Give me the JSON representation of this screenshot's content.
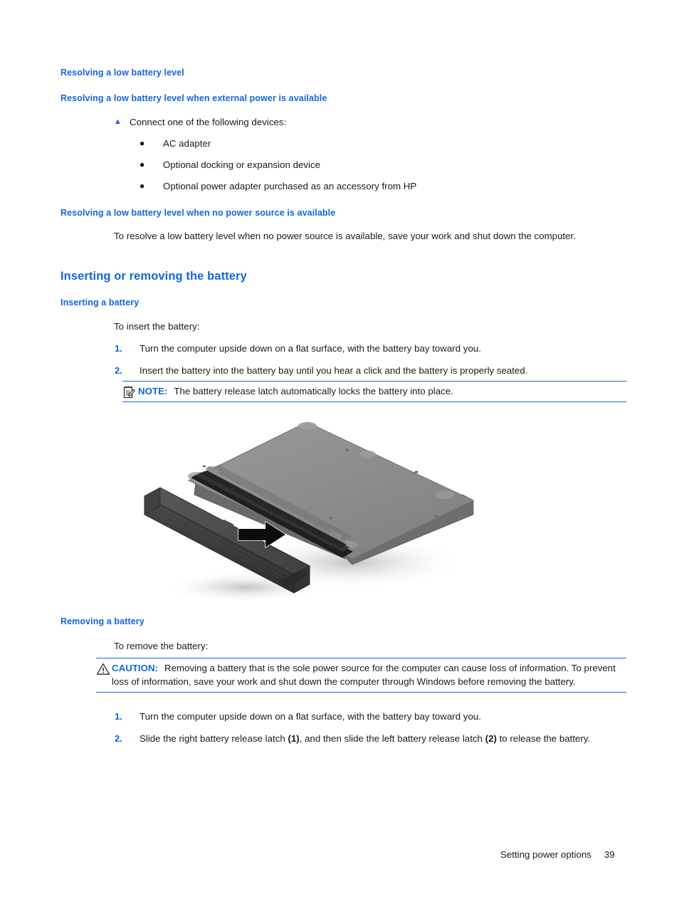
{
  "document": {
    "headings": {
      "resolving_low_battery": "Resolving a low battery level",
      "resolving_external_power": "Resolving a low battery level when external power is available",
      "resolving_no_power": "Resolving a low battery level when no power source is available",
      "inserting_removing": "Inserting or removing the battery",
      "inserting_battery": "Inserting a battery",
      "removing_battery": "Removing a battery"
    },
    "connect_step": {
      "marker": "▲",
      "text": "Connect one of the following devices:"
    },
    "device_bullets": [
      {
        "marker": "●",
        "label": "AC adapter"
      },
      {
        "marker": "●",
        "label": "Optional docking or expansion device"
      },
      {
        "marker": "●",
        "label": "Optional power adapter purchased as an accessory from HP"
      }
    ],
    "no_power_paragraph": "To resolve a low battery level when no power source is available, save your work and shut down the computer.",
    "insert_intro": "To insert the battery:",
    "insert_steps": [
      {
        "marker": "1.",
        "text": "Turn the computer upside down on a flat surface, with the battery bay toward you."
      },
      {
        "marker": "2.",
        "text": "Insert the battery into the battery bay until you hear a click and the battery is properly seated."
      }
    ],
    "note": {
      "icon": "note-icon",
      "keyword": "NOTE:",
      "text": "The battery release latch automatically locks the battery into place."
    },
    "figure": {
      "name": "battery-insertion-illustration",
      "description": "Laptop shown upside down with battery being inserted into the battery bay, arrow indicating insertion direction",
      "colors": {
        "laptop_body": "#8d8d8d",
        "laptop_edge": "#6f6f6f",
        "battery": "#3c3c3c",
        "bay_shadow": "#2a2a2a",
        "arrow": "#111111"
      }
    },
    "remove_intro": "To remove the battery:",
    "caution": {
      "icon": "warning-triangle-icon",
      "keyword": "CAUTION:",
      "text": "Removing a battery that is the sole power source for the computer can cause loss of information. To prevent loss of information, save your work and shut down the computer through Windows before removing the battery."
    },
    "remove_steps": [
      {
        "marker": "1.",
        "text_before": "Turn the computer upside down on a flat surface, with the battery bay toward you.",
        "bold1": "",
        "text_mid": "",
        "bold2": "",
        "text_after": ""
      },
      {
        "marker": "2.",
        "text_before": "Slide the right battery release latch ",
        "bold1": "(1)",
        "text_mid": ", and then slide the left battery release latch ",
        "bold2": "(2)",
        "text_after": " to release the battery."
      }
    ],
    "footer": {
      "section": "Setting power options",
      "page_number": "39"
    },
    "colors": {
      "heading_blue": "#1266e0",
      "rule_blue": "#1266e0",
      "body_text": "#1a1a1a",
      "background": "#ffffff"
    }
  }
}
